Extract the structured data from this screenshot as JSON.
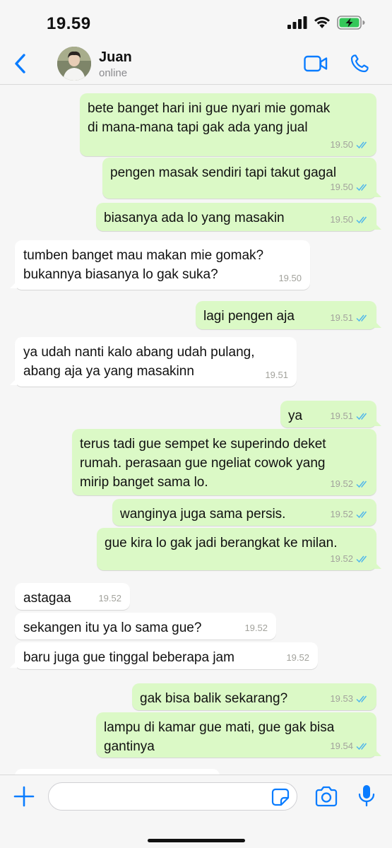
{
  "status_bar": {
    "time": "19.59"
  },
  "header": {
    "contact_name": "Juan",
    "contact_status": "online"
  },
  "colors": {
    "accent": "#0a7cff",
    "outgoing_bubble": "#dbf9c6",
    "incoming_bubble": "#ffffff",
    "read_ticks": "#4fb6ec",
    "battery_green": "#34c759"
  },
  "icons": [
    "signal-icon",
    "wifi-icon",
    "battery-charging-icon",
    "back-chevron-icon",
    "video-call-icon",
    "phone-icon",
    "plus-icon",
    "sticker-icon",
    "camera-icon",
    "microphone-icon",
    "read-ticks-icon"
  ],
  "messages": [
    {
      "dir": "out",
      "text": "bete banget hari ini gue nyari mie gomak\ndi mana-mana tapi gak ada yang jual",
      "time": "19.50",
      "read": true
    },
    {
      "dir": "out",
      "text": "pengen masak sendiri tapi takut gagal",
      "time": "19.50",
      "read": true
    },
    {
      "dir": "out",
      "text": "biasanya ada lo yang masakin",
      "time": "19.50",
      "read": true
    },
    {
      "dir": "in",
      "text": "tumben banget mau makan mie gomak?\nbukannya biasanya lo gak suka?",
      "time": "19.50"
    },
    {
      "dir": "out",
      "text": "lagi pengen aja",
      "time": "19.51",
      "read": true
    },
    {
      "dir": "in",
      "text": "ya udah nanti kalo abang udah pulang,\nabang aja ya yang masakinn",
      "time": "19.51"
    },
    {
      "dir": "out",
      "text": "ya",
      "time": "19.51",
      "read": true
    },
    {
      "dir": "out",
      "text": "terus tadi gue sempet ke superindo deket\nrumah. perasaan gue ngeliat cowok yang\nmirip banget sama lo.",
      "time": "19.52",
      "read": true
    },
    {
      "dir": "out",
      "text": "wanginya juga sama persis.",
      "time": "19.52",
      "read": true
    },
    {
      "dir": "out",
      "text": "gue kira lo gak jadi berangkat ke milan.",
      "time": "19.52",
      "read": true
    },
    {
      "dir": "in",
      "text": "astagaa",
      "time": "19.52"
    },
    {
      "dir": "in",
      "text": "sekangen itu ya lo sama gue?",
      "time": "19.52"
    },
    {
      "dir": "in",
      "text": "baru juga gue tinggal beberapa jam",
      "time": "19.52"
    },
    {
      "dir": "out",
      "text": "gak bisa balik sekarang?",
      "time": "19.53",
      "read": true
    },
    {
      "dir": "out",
      "text": "lampu di kamar gue mati, gue gak bisa\ngantinya",
      "time": "19.54",
      "read": true
    }
  ],
  "input": {
    "placeholder": "",
    "value": ""
  }
}
